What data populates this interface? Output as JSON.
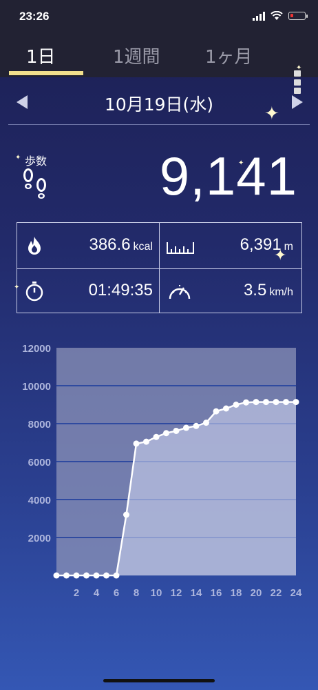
{
  "status_bar": {
    "time": "23:26"
  },
  "tabs": [
    {
      "label": "1日",
      "active": true
    },
    {
      "label": "1週間",
      "active": false
    },
    {
      "label": "1ヶ月",
      "active": false
    }
  ],
  "date": "10月19日(水)",
  "steps": {
    "label": "歩数",
    "value": "9,141"
  },
  "stats": {
    "calories": {
      "value": "386.6",
      "unit": "kcal",
      "icon": "flame-icon"
    },
    "distance": {
      "value": "6,391",
      "unit": "m",
      "icon": "ruler-icon"
    },
    "duration": {
      "value": "01:49:35",
      "icon": "stopwatch-icon"
    },
    "speed": {
      "value": "3.5",
      "unit": "km/h",
      "icon": "speedometer-icon"
    }
  },
  "chart_data": {
    "type": "area",
    "x": [
      0,
      1,
      2,
      3,
      4,
      5,
      6,
      7,
      8,
      9,
      10,
      11,
      12,
      13,
      14,
      15,
      16,
      17,
      18,
      19,
      20,
      21,
      22,
      23,
      24
    ],
    "values": [
      0,
      0,
      0,
      0,
      0,
      0,
      0,
      3200,
      6950,
      7050,
      7300,
      7500,
      7620,
      7780,
      7880,
      8050,
      8650,
      8800,
      9000,
      9120,
      9141,
      9141,
      9141,
      9141,
      9141
    ],
    "xticks": [
      "2",
      "4",
      "6",
      "8",
      "10",
      "12",
      "14",
      "16",
      "18",
      "20",
      "22",
      "24"
    ],
    "yticks": [
      "2000",
      "4000",
      "6000",
      "8000",
      "10000",
      "12000"
    ],
    "xlim": [
      0,
      24
    ],
    "ylim": [
      0,
      12000
    ],
    "grid": true,
    "colors": {
      "grid": "#2f4aa0",
      "line": "#ffffff",
      "fill": "#c9d0ec",
      "plot_bg": "#8c93b8"
    }
  }
}
